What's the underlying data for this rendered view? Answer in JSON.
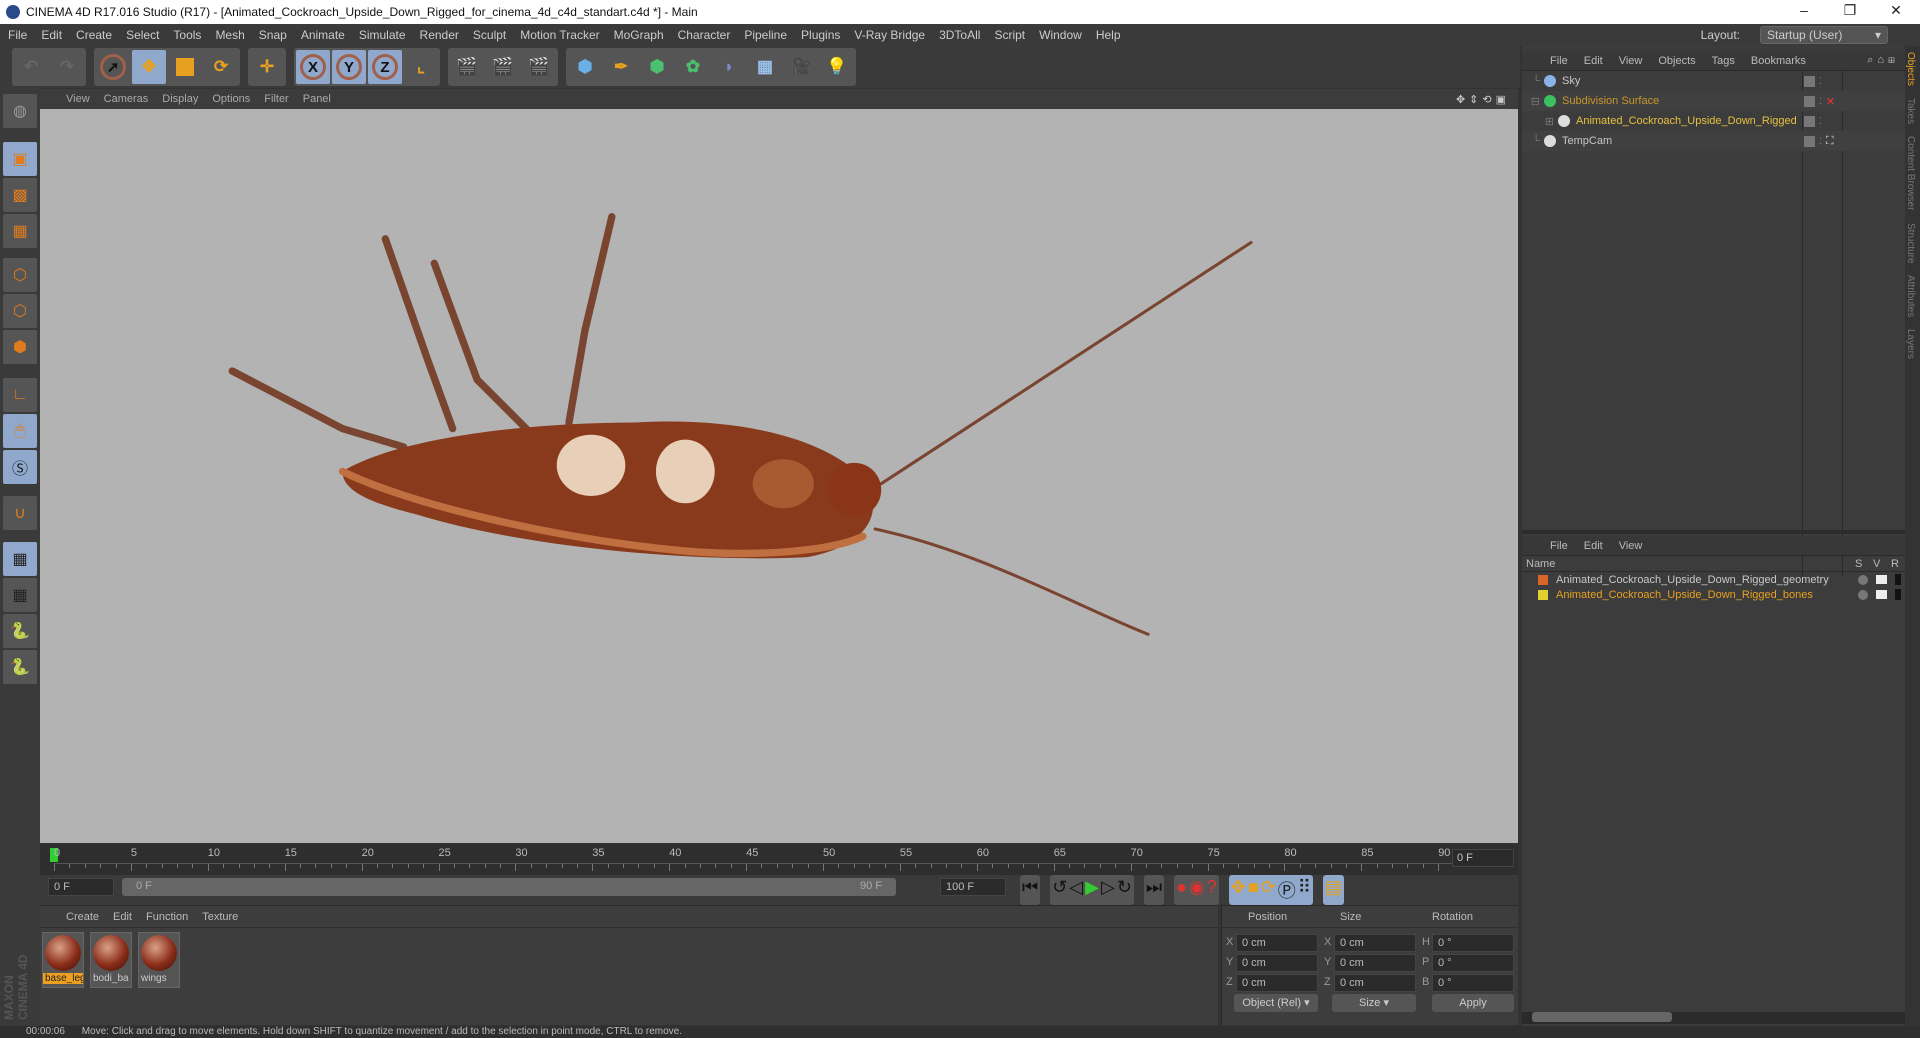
{
  "window": {
    "title": "CINEMA 4D R17.016 Studio (R17) - [Animated_Cockroach_Upside_Down_Rigged_for_cinema_4d_c4d_standart.c4d *] - Main",
    "minimize": "–",
    "restore": "❐",
    "close": "✕"
  },
  "menu": [
    "File",
    "Edit",
    "Create",
    "Select",
    "Tools",
    "Mesh",
    "Snap",
    "Animate",
    "Simulate",
    "Render",
    "Sculpt",
    "Motion Tracker",
    "MoGraph",
    "Character",
    "Pipeline",
    "Plugins",
    "V-Ray Bridge",
    "3DToAll",
    "Script",
    "Window",
    "Help"
  ],
  "layout": {
    "label": "Layout:",
    "value": "Startup (User)"
  },
  "toolbar": {
    "x": "X",
    "y": "Y",
    "z": "Z"
  },
  "viewport_menu": [
    "View",
    "Cameras",
    "Display",
    "Options",
    "Filter",
    "Panel"
  ],
  "timeline": {
    "ticks": [
      "0",
      "5",
      "10",
      "15",
      "20",
      "25",
      "30",
      "35",
      "40",
      "45",
      "50",
      "55",
      "60",
      "65",
      "70",
      "75",
      "80",
      "85",
      "90"
    ],
    "current_frame": "0 F",
    "start": "0 F",
    "range_start": "0 F",
    "range_end": "90 F",
    "end": "100 F"
  },
  "materials": {
    "menu": [
      "Create",
      "Edit",
      "Function",
      "Texture"
    ],
    "items": [
      "base_leg",
      "bodi_ba",
      "wings"
    ]
  },
  "coords": {
    "headers": [
      "Position",
      "Size",
      "Rotation"
    ],
    "pos": [
      {
        "axis": "X",
        "val": "0 cm"
      },
      {
        "axis": "Y",
        "val": "0 cm"
      },
      {
        "axis": "Z",
        "val": "0 cm"
      }
    ],
    "size": [
      {
        "axis": "X",
        "val": "0 cm"
      },
      {
        "axis": "Y",
        "val": "0 cm"
      },
      {
        "axis": "Z",
        "val": "0 cm"
      }
    ],
    "rot": [
      {
        "axis": "H",
        "val": "0 °"
      },
      {
        "axis": "P",
        "val": "0 °"
      },
      {
        "axis": "B",
        "val": "0 °"
      }
    ],
    "mode": "Object (Rel)",
    "size_mode": "Size",
    "apply": "Apply"
  },
  "objects": {
    "menu": [
      "File",
      "Edit",
      "View",
      "Objects",
      "Tags",
      "Bookmarks"
    ],
    "items": [
      {
        "name": "Sky",
        "color": "#c8c8c8"
      },
      {
        "name": "Subdivision Surface",
        "color": "#c9962a"
      },
      {
        "name": "Animated_Cockroach_Upside_Down_Rigged",
        "color": "#e8c040"
      },
      {
        "name": "TempCam",
        "color": "#c8c8c8"
      }
    ]
  },
  "layers": {
    "menu": [
      "File",
      "Edit",
      "View"
    ],
    "col_name": "Name",
    "col_s": "S",
    "col_v": "V",
    "col_r": "R",
    "items": [
      {
        "name": "Animated_Cockroach_Upside_Down_Rigged_geometry",
        "color": "#d9652a",
        "text": "#c8c8c8"
      },
      {
        "name": "Animated_Cockroach_Upside_Down_Rigged_bones",
        "color": "#e0d030",
        "text": "#e8a020"
      }
    ]
  },
  "side_tabs": [
    "Objects",
    "Takes",
    "Content Browser",
    "Structure",
    "Attributes",
    "Layers"
  ],
  "status": {
    "time": "00:00:06",
    "message": "Move: Click and drag to move elements. Hold down SHIFT to quantize movement / add to the selection in point mode, CTRL to remove."
  },
  "brand": "MAXON CINEMA 4D"
}
